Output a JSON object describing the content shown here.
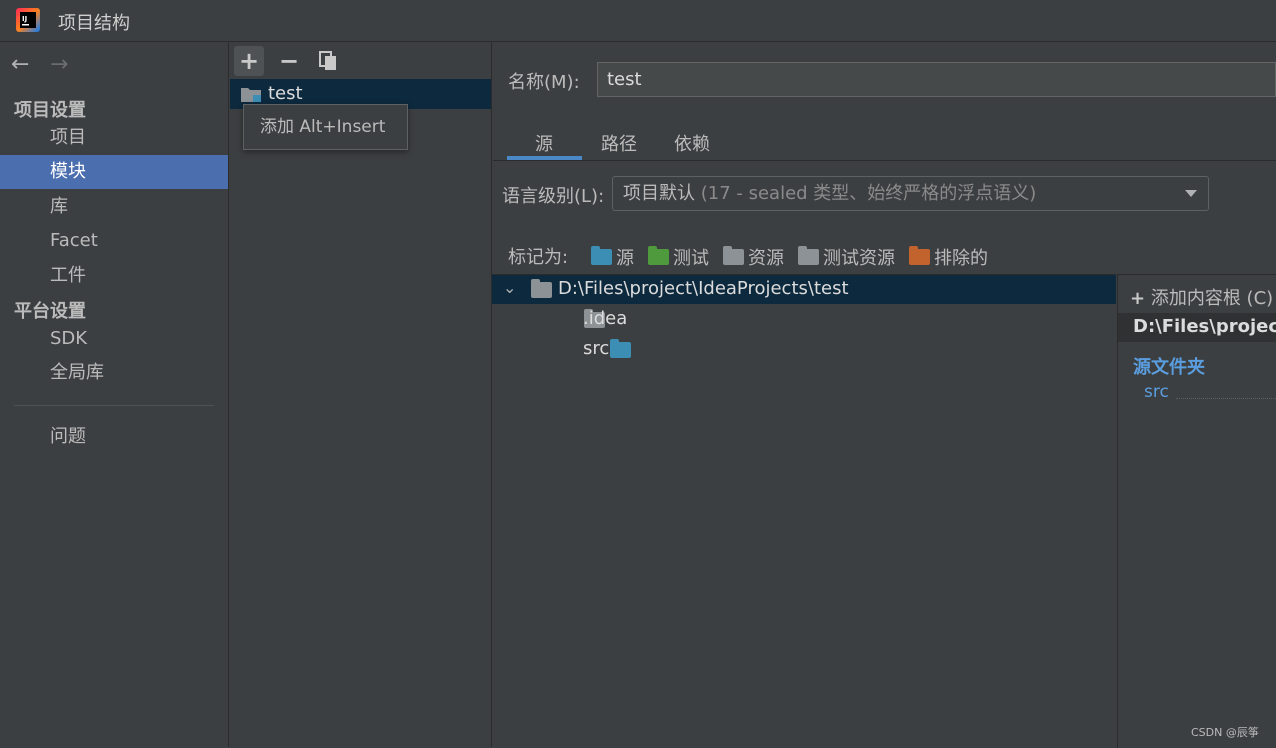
{
  "window": {
    "title": "项目结构"
  },
  "nav": {
    "back_icon": "arrow-left-icon",
    "forward_icon": "arrow-right-icon",
    "project_settings": {
      "heading": "项目设置",
      "items": [
        "项目",
        "模块",
        "库",
        "Facet",
        "工件"
      ],
      "selected": "模块"
    },
    "platform_settings": {
      "heading": "平台设置",
      "items": [
        "SDK",
        "全局库"
      ]
    },
    "problems": "问题"
  },
  "modules": {
    "toolbar": {
      "add": "+",
      "remove": "−",
      "copy_icon": "copy-icon"
    },
    "items": [
      "test"
    ],
    "tooltip": "添加  Alt+Insert"
  },
  "module_detail": {
    "name_label": "名称(M):",
    "name_value": "test",
    "tabs": [
      "源",
      "路径",
      "依赖"
    ],
    "active_tab": "源",
    "language_level_label": "语言级别(L):",
    "language_level_value": "项目默认",
    "language_level_hint": "(17 - sealed 类型、始终严格的浮点语义)",
    "mark_as_label": "标记为:",
    "mark_as": [
      {
        "label": "源",
        "color": "#3d8eb5"
      },
      {
        "label": "测试",
        "color": "#4e9a3c"
      },
      {
        "label": "资源",
        "color": "#8c9296"
      },
      {
        "label": "测试资源",
        "color": "#8c9296"
      },
      {
        "label": "排除的",
        "color": "#c2622d"
      }
    ],
    "tree": {
      "root": "D:\\Files\\project\\IdeaProjects\\test",
      "children": [
        {
          "label": ".idea",
          "color": "#8c9296"
        },
        {
          "label": "src",
          "color": "#3d8eb5"
        }
      ]
    },
    "content_root_panel": {
      "add_content_root": "添加内容根 (C)",
      "root_path": "D:\\Files\\project\\",
      "source_folders_title": "源文件夹",
      "source_folders": [
        "src"
      ]
    }
  },
  "watermark": "CSDN @辰筝"
}
